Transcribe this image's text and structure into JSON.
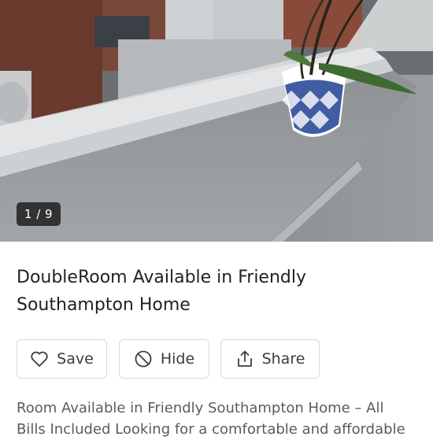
{
  "gallery": {
    "counter": "1 / 9"
  },
  "listing": {
    "title_line1": "DoubleRoom Available in Friendly",
    "title_line2": "Southampton Home",
    "description_line1": "Room Available in Friendly Southampton Home – All",
    "description_line2": "Bills Included Looking for a comfortable and affordable"
  },
  "actions": {
    "save": {
      "label": "Save",
      "icon": "heart-icon"
    },
    "hide": {
      "label": "Hide",
      "icon": "block-icon"
    },
    "share": {
      "label": "Share",
      "icon": "share-icon"
    }
  }
}
